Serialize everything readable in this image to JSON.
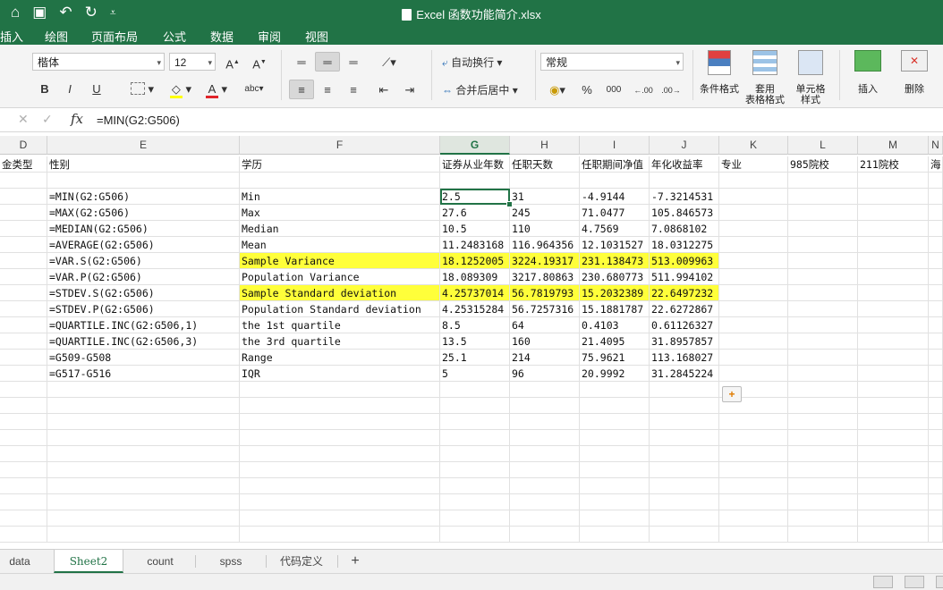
{
  "window": {
    "title": "Excel 函数功能简介.xlsx"
  },
  "quick_access": {
    "home_icon": "home-icon",
    "save_icon": "save-icon",
    "undo_icon": "undo-icon",
    "redo_icon": "redo-icon",
    "more_icon": "customize-icon"
  },
  "menu_tabs": [
    "插入",
    "绘图",
    "页面布局",
    "公式",
    "数据",
    "审阅",
    "视图"
  ],
  "ribbon": {
    "font_name": "楷体",
    "font_size": "12",
    "bold": "B",
    "italic": "I",
    "underline": "U",
    "wrap_text": "自动换行",
    "merge_center": "合并后居中",
    "number_format": "常规",
    "percent": "%",
    "thousands": "000",
    "conditional_format": "条件格式",
    "table_format": "套用\n表格格式",
    "cell_styles": "单元格\n样式",
    "insert": "插入",
    "delete": "删除",
    "font_color": "#e0242a",
    "fill_color": "#ffff00"
  },
  "formula_bar": {
    "formula": "=MIN(G2:G506)",
    "fx": "fx"
  },
  "columns": [
    {
      "letter": "D",
      "header": "金类型"
    },
    {
      "letter": "E",
      "header": "性别"
    },
    {
      "letter": "F",
      "header": "学历"
    },
    {
      "letter": "G",
      "header": "证券从业年数"
    },
    {
      "letter": "H",
      "header": "任职天数"
    },
    {
      "letter": "I",
      "header": "任职期间净值"
    },
    {
      "letter": "J",
      "header": "年化收益率"
    },
    {
      "letter": "K",
      "header": "专业"
    },
    {
      "letter": "L",
      "header": "985院校"
    },
    {
      "letter": "M",
      "header": "211院校"
    },
    {
      "letter": "N",
      "header": "海"
    }
  ],
  "rows": [
    {
      "e": "=MIN(G2:G506)",
      "f": "Min",
      "g": "2.5",
      "h": "31",
      "i": "-4.9144",
      "j": "-7.3214531",
      "hl": false
    },
    {
      "e": "=MAX(G2:G506)",
      "f": "Max",
      "g": "27.6",
      "h": "245",
      "i": "71.0477",
      "j": "105.846573",
      "hl": false
    },
    {
      "e": "=MEDIAN(G2:G506)",
      "f": "Median",
      "g": "10.5",
      "h": "110",
      "i": "4.7569",
      "j": "7.0868102",
      "hl": false
    },
    {
      "e": "=AVERAGE(G2:G506)",
      "f": "Mean",
      "g": "11.2483168",
      "h": "116.964356",
      "i": "12.1031527",
      "j": "18.0312275",
      "hl": false
    },
    {
      "e": "=VAR.S(G2:G506)",
      "f": "Sample Variance",
      "g": "18.1252005",
      "h": "3224.19317",
      "i": "231.138473",
      "j": "513.009963",
      "hl": true
    },
    {
      "e": "=VAR.P(G2:G506)",
      "f": "Population Variance",
      "g": "18.089309",
      "h": "3217.80863",
      "i": "230.680773",
      "j": "511.994102",
      "hl": false
    },
    {
      "e": "=STDEV.S(G2:G506)",
      "f": "Sample Standard deviation",
      "g": "4.25737014",
      "h": "56.7819793",
      "i": "15.2032389",
      "j": "22.6497232",
      "hl": true
    },
    {
      "e": "=STDEV.P(G2:G506)",
      "f": "Population Standard deviation",
      "g": "4.25315284",
      "h": "56.7257316",
      "i": "15.1881787",
      "j": "22.6272867",
      "hl": false
    },
    {
      "e": "=QUARTILE.INC(G2:G506,1)",
      "f": "the 1st quartile",
      "g": "8.5",
      "h": "64",
      "i": "0.4103",
      "j": "0.61126327",
      "hl": false
    },
    {
      "e": "=QUARTILE.INC(G2:G506,3)",
      "f": "the 3rd quartile",
      "g": "13.5",
      "h": "160",
      "i": "21.4095",
      "j": "31.8957857",
      "hl": false
    },
    {
      "e": "=G509-G508",
      "f": "Range",
      "g": "25.1",
      "h": "214",
      "i": "75.9621",
      "j": "113.168027",
      "hl": false
    },
    {
      "e": "=G517-G516",
      "f": "IQR",
      "g": "5",
      "h": "96",
      "i": "20.9992",
      "j": "31.2845224",
      "hl": false
    }
  ],
  "sheet_tabs": [
    "data",
    "Sheet2",
    "count",
    "spss",
    "代码定义"
  ],
  "active_sheet": "Sheet2",
  "add_sheet": "+",
  "highlight_color": "#ffff3a",
  "accent": "#217346"
}
